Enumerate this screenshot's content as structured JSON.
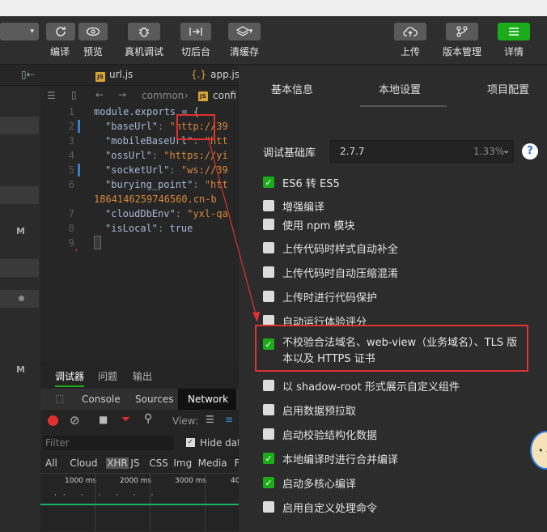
{
  "toolbar": {
    "compile": "编译",
    "preview": "预览",
    "remote_debug": "真机调试",
    "background": "切后台",
    "clear_cache": "清缓存",
    "upload": "上传",
    "version_mgmt": "版本管理",
    "details": "详情"
  },
  "tabs": {
    "file1": "url.js",
    "file2": "app.jso"
  },
  "editor": {
    "breadcrumb_dir": "common",
    "breadcrumb_file": "confi",
    "lines": [
      {
        "n": "1",
        "t": "module.exports = {"
      },
      {
        "n": "2",
        "k": "\"baseUrl\"",
        "v": "\"http://39"
      },
      {
        "n": "3",
        "k": "\"mobileBaseUrl\"",
        "v": "\"htt"
      },
      {
        "n": "4",
        "k": "\"ossUrl\"",
        "v": "\"https://yi"
      },
      {
        "n": "5",
        "k": "\"socketUrl\"",
        "v": "\"ws://39"
      },
      {
        "n": "6",
        "k": "\"burying_point\"",
        "v": "\"htt"
      },
      {
        "n": "",
        "t": "1864146259746560.cn-b"
      },
      {
        "n": "7",
        "k": "\"cloudDbEnv\"",
        "v": "\"yxl-qa"
      },
      {
        "n": "8",
        "k": "\"isLocal\"",
        "v": "true"
      },
      {
        "n": "9",
        "t": "}"
      }
    ]
  },
  "debug": {
    "tabs": [
      "调试器",
      "问题",
      "输出"
    ],
    "panel_tabs": [
      "Console",
      "Sources",
      "Network"
    ],
    "view_label": "View:",
    "filter_placeholder": "Filter",
    "hide_data": "Hide data",
    "types": [
      "All",
      "Cloud",
      "XHR",
      "JS",
      "CSS",
      "Img",
      "Media",
      "Fo"
    ],
    "timeline": [
      "1000 ms",
      "2000 ms",
      "3000 ms",
      "40"
    ]
  },
  "left_strip": {
    "m1": "M",
    "m2": "M"
  },
  "settings": {
    "tabs": [
      "基本信息",
      "本地设置",
      "项目配置"
    ],
    "lib_label": "调试基础库",
    "lib_version": "2.7.7",
    "lib_percent": "1.33%",
    "help": "?",
    "options": [
      {
        "label": "ES6 转 ES5",
        "checked": true
      },
      {
        "label": "增强编译",
        "checked": false
      },
      {
        "label": "使用 npm 模块",
        "checked": false
      },
      {
        "label": "上传代码时样式自动补全",
        "checked": false
      },
      {
        "label": "上传代码时自动压缩混淆",
        "checked": false
      },
      {
        "label": "上传时进行代码保护",
        "checked": false
      },
      {
        "label": "自动运行体验评分",
        "checked": false
      },
      {
        "label": "不校验合法域名、web-view（业务域名）、TLS 版",
        "label2": "本以及 HTTPS 证书",
        "checked": true
      },
      {
        "label": "以 shadow-root 形式展示自定义组件",
        "checked": false
      },
      {
        "label": "启用数据预拉取",
        "checked": false
      },
      {
        "label": "启动校验结构化数据",
        "checked": false
      },
      {
        "label": "本地编译时进行合并编译",
        "checked": true
      },
      {
        "label": "启动多核心编译",
        "checked": true
      },
      {
        "label": "启用自定义处理命令",
        "checked": false
      }
    ]
  },
  "colors": {
    "accent": "#1aad19",
    "highlight": "#e03131",
    "bg": "#2c2c2c"
  }
}
